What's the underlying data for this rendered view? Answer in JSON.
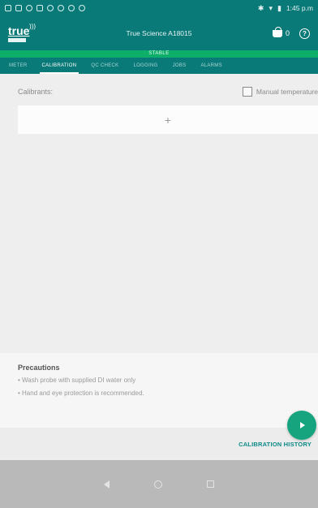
{
  "status_bar": {
    "time": "1:45 p.m",
    "icons_left": [
      "notification-icon",
      "image-icon",
      "app-icon",
      "app-icon",
      "app-icon",
      "app-icon",
      "app-icon",
      "app-icon"
    ],
    "icons_right": [
      "bluetooth-icon",
      "wifi-icon",
      "battery-icon"
    ],
    "bluetooth_glyph": "✱",
    "wifi_glyph": "▾",
    "battery_glyph": "▮"
  },
  "app_bar": {
    "logo_text": "true",
    "title": "True Science A18015",
    "basket_count": "0",
    "help_glyph": "?"
  },
  "stability": "STABLE",
  "tabs": [
    {
      "label": "METER"
    },
    {
      "label": "CALIBRATION"
    },
    {
      "label": "QC CHECK"
    },
    {
      "label": "LOGGING"
    },
    {
      "label": "JOBS"
    },
    {
      "label": "ALARMS"
    }
  ],
  "active_tab": "CALIBRATION",
  "calibrants": {
    "label": "Calibrants:",
    "manual_temperature_label": "Manual temperature",
    "manual_temperature_checked": false,
    "add_glyph": "+"
  },
  "precautions": {
    "title": "Precautions",
    "items": [
      "• Wash probe with supplied DI water only",
      "• Hand and eye protection is recommended."
    ]
  },
  "footer": {
    "history_button": "CALIBRATION HISTORY"
  },
  "colors": {
    "primary": "#0a7a78",
    "stable": "#0cae69",
    "fab": "#16a47e",
    "accent_text": "#0a8a88"
  }
}
